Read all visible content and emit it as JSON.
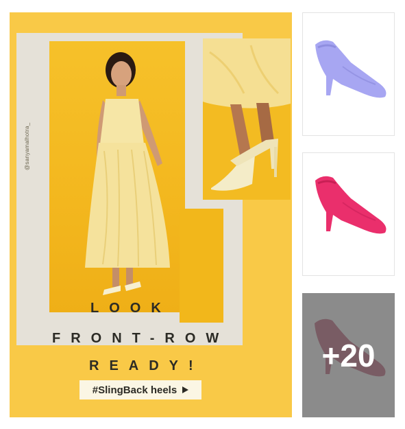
{
  "main_post": {
    "photo_credit": "@sanyamalhotra_",
    "headline_line1": "LOOK",
    "headline_line2": "FRONT-ROW",
    "headline_line3": "READY!",
    "hashtag": "#SlingBack heels",
    "accent_color": "#f9c947"
  },
  "thumbnails": [
    {
      "item": "lavender slingback heel",
      "color": "#a7a6f2"
    },
    {
      "item": "pink slingback heel",
      "color": "#ea2f6c"
    },
    {
      "item": "burgundy slingback heel",
      "color": "#a3163f"
    }
  ],
  "more_count": "+20"
}
